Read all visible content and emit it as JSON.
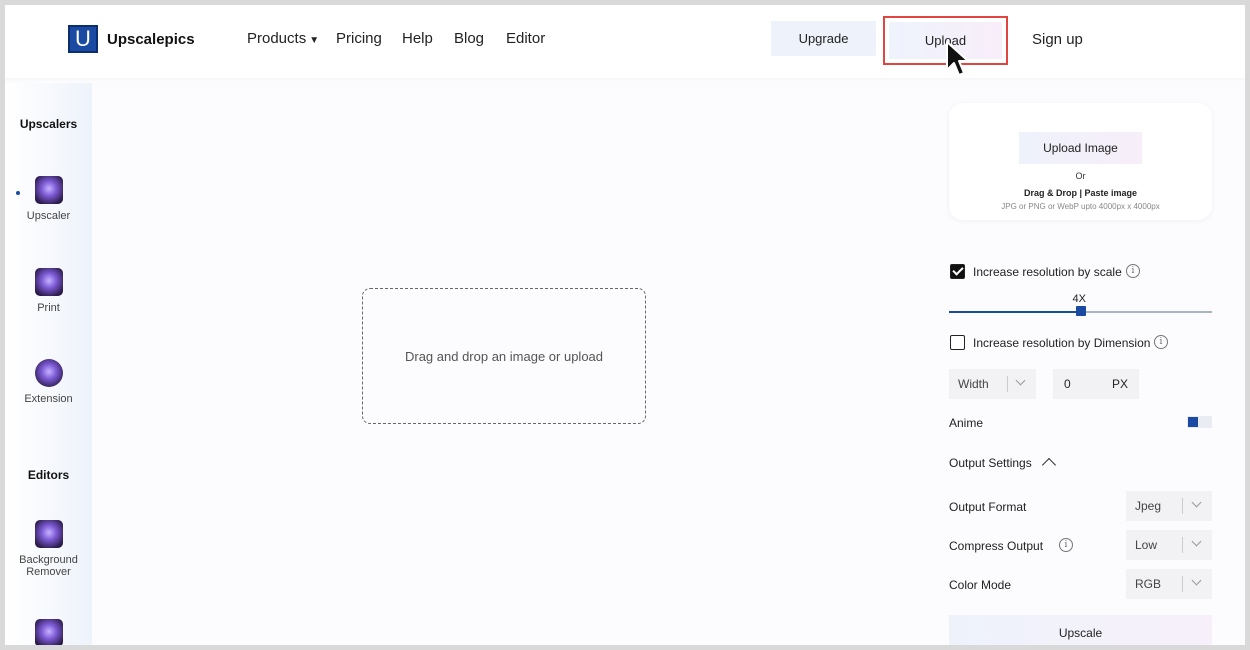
{
  "header": {
    "logo_letter": "U",
    "brand": "Upscalepics",
    "nav": [
      {
        "label": "Products",
        "caret": "▼"
      },
      {
        "label": "Pricing"
      },
      {
        "label": "Help"
      },
      {
        "label": "Blog"
      },
      {
        "label": "Editor"
      }
    ],
    "upgrade_label": "Upgrade",
    "upload_label": "Upload",
    "signup_label": "Sign up"
  },
  "sidebar": {
    "upscalers_heading": "Upscalers",
    "upscaler_items": [
      "Upscaler",
      "Print",
      "Extension"
    ],
    "editors_heading": "Editors",
    "editor_items": [
      "Background",
      "Remover"
    ]
  },
  "main": {
    "dropzone_text": "Drag and drop an image or upload"
  },
  "panel": {
    "upload_image_label": "Upload Image",
    "or_text": "Or",
    "drag_drop_text": "Drag & Drop | Paste image",
    "hint_text": "JPG or PNG or WebP upto 4000px x 4000px",
    "scale_label": "Increase resolution by scale",
    "scale_checked": true,
    "scale_value_label": "4X",
    "scale_fraction": 0.5,
    "dimension_label": "Increase resolution by Dimension",
    "dimension_checked": false,
    "width_select": "Width",
    "px_value": "0",
    "px_unit": "PX",
    "anime_label": "Anime",
    "output_settings_label": "Output Settings",
    "output_format_label": "Output Format",
    "output_format_value": "Jpeg",
    "compress_label": "Compress Output",
    "compress_value": "Low",
    "color_mode_label": "Color Mode",
    "color_mode_value": "RGB",
    "upscale_label": "Upscale",
    "info_glyph": "i"
  },
  "colors": {
    "accent": "#1a4aa1",
    "highlight": "#e0463f"
  }
}
